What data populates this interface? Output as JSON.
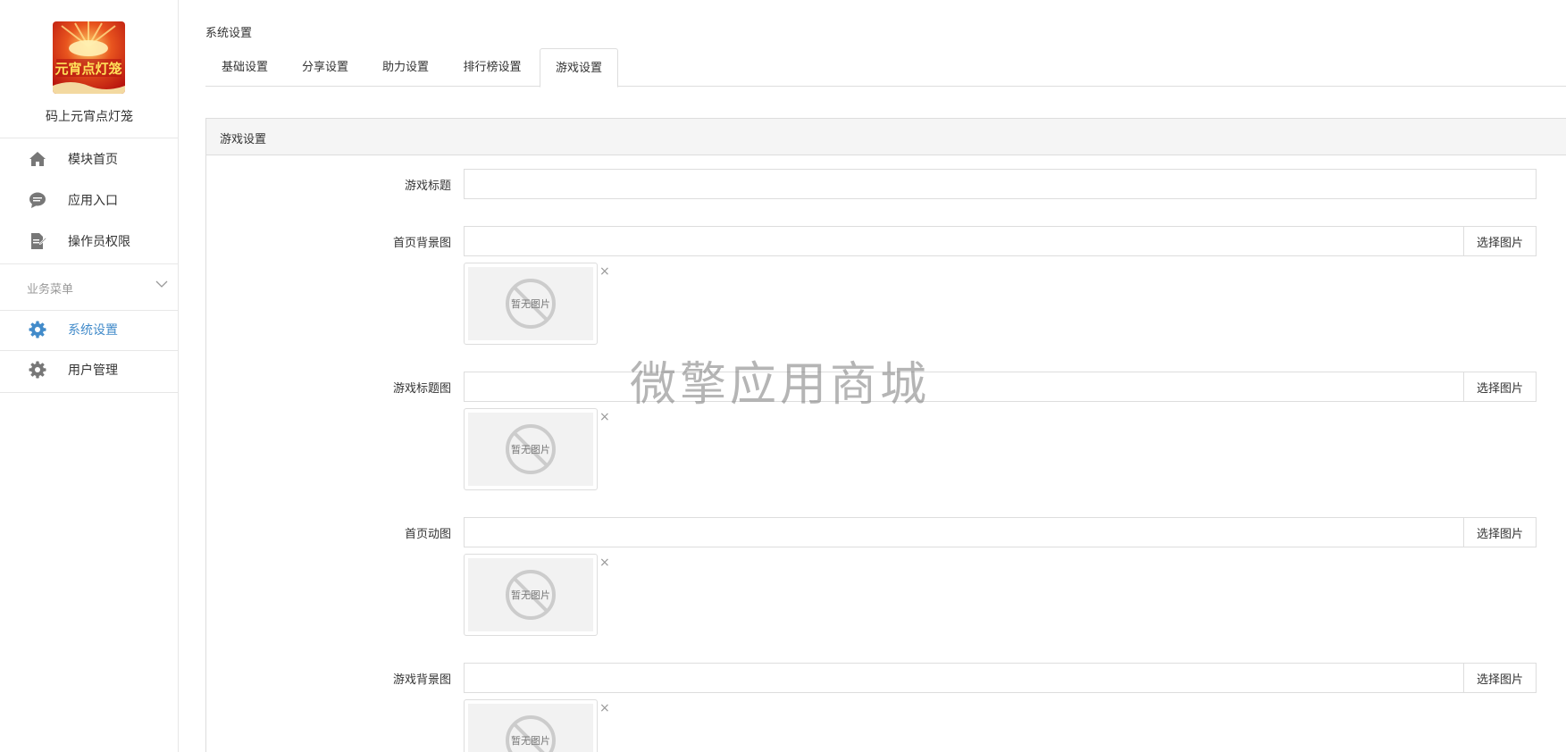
{
  "sidebar": {
    "app_name": "码上元宵点灯笼",
    "logo_text": "元宵点灯笼",
    "items": [
      {
        "label": "模块首页",
        "icon": "home-icon"
      },
      {
        "label": "应用入口",
        "icon": "chat-bubble-icon"
      },
      {
        "label": "操作员权限",
        "icon": "document-edit-icon"
      }
    ],
    "group_title": "业务菜单",
    "group_items": [
      {
        "label": "系统设置",
        "icon": "gear-icon",
        "active": true
      },
      {
        "label": "用户管理",
        "icon": "gear-icon",
        "active": false
      }
    ],
    "active_color": "#428bca"
  },
  "breadcrumb": "系统设置",
  "tabs": [
    {
      "label": "基础设置"
    },
    {
      "label": "分享设置"
    },
    {
      "label": "助力设置"
    },
    {
      "label": "排行榜设置"
    },
    {
      "label": "游戏设置",
      "active": true
    }
  ],
  "panel": {
    "title": "游戏设置",
    "fields": [
      {
        "label": "游戏标题",
        "value": ""
      },
      {
        "label": "首页背景图",
        "value": "",
        "button": "选择图片",
        "placeholder_image_text": "暂无图片"
      },
      {
        "label": "游戏标题图",
        "value": "",
        "button": "选择图片",
        "placeholder_image_text": "暂无图片"
      },
      {
        "label": "首页动图",
        "value": "",
        "button": "选择图片",
        "placeholder_image_text": "暂无图片"
      },
      {
        "label": "游戏背景图",
        "value": "",
        "button": "选择图片",
        "placeholder_image_text": "暂无图片"
      }
    ],
    "remove_glyph": "×"
  },
  "watermark": "微擎应用商城"
}
